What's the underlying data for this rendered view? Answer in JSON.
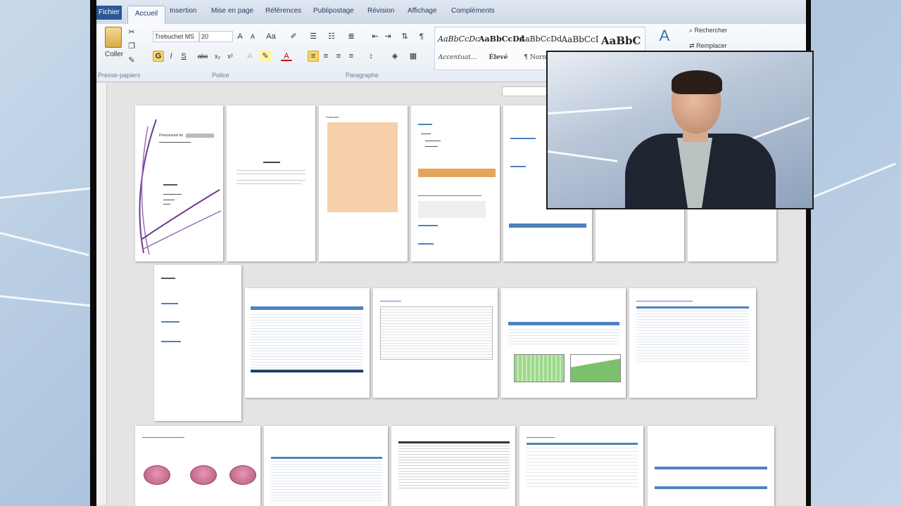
{
  "ribbon": {
    "tabs": [
      "Fichier",
      "Accueil",
      "Insertion",
      "Mise en page",
      "Références",
      "Publipostage",
      "Révision",
      "Affichage",
      "Compléments"
    ],
    "clipboard": {
      "paste_label": "Coller",
      "group_label": "Presse-papiers"
    },
    "font": {
      "name": "Trebuchet MS",
      "size": "20",
      "group_label": "Police"
    },
    "format_buttons": [
      "G",
      "I",
      "S",
      "abc",
      "x₂",
      "x²"
    ],
    "paragraph_group_label": "Paragraphe",
    "styles": [
      {
        "preview": "AaBbCcDc",
        "name": "Accentuat..."
      },
      {
        "preview": "AaBbCcDd",
        "name": "Élevé"
      },
      {
        "preview": "AaBbCcDd",
        "name": "¶ Norm..."
      },
      {
        "preview": "AaBbCcI",
        "name": ""
      },
      {
        "preview": "AaBbC",
        "name": ""
      }
    ],
    "editing": {
      "find_label": "Rechercher",
      "replace_label": "Remplacer"
    }
  },
  "document": {
    "cover_title": "Prévisionnel de",
    "toc_heading": "Sommaire"
  },
  "colors": {
    "accent": "#4f81bd",
    "file_tab": "#2b5797",
    "highlight": "#f3c08f"
  }
}
